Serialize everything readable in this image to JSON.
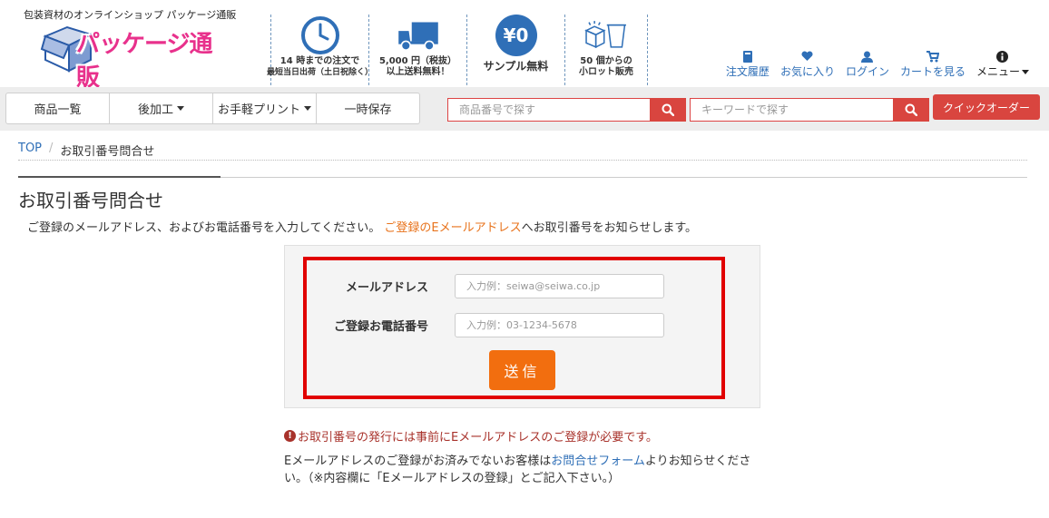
{
  "header": {
    "tagline": "包装資材のオンラインショップ パッケージ通販",
    "logo_text": "パッケージ通販",
    "features": [
      {
        "icon": "clock-icon",
        "line1": "14 時までの注文で",
        "line2": "最短当日出荷（土日祝除く）"
      },
      {
        "icon": "truck-icon",
        "line1": "5,000 円（税抜）",
        "line2": "以上送料無料！"
      },
      {
        "icon": "yen-zero-icon",
        "icon_text": "¥0",
        "line1": "サンプル無料",
        "line2": ""
      },
      {
        "icon": "box-cup-icon",
        "line1": "50 個からの",
        "line2": "小ロット販売"
      }
    ]
  },
  "user_nav": [
    {
      "icon": "book-icon",
      "label": "注文履歴"
    },
    {
      "icon": "heart-icon",
      "label": "お気に入り"
    },
    {
      "icon": "user-icon",
      "label": "ログイン"
    },
    {
      "icon": "cart-icon",
      "label": "カートを見る"
    },
    {
      "icon": "info-icon",
      "label": "メニュー"
    }
  ],
  "navbar": {
    "buttons": [
      {
        "label": "商品一覧",
        "dropdown": false
      },
      {
        "label": "後加工",
        "dropdown": true
      },
      {
        "label": "お手軽プリント",
        "dropdown": true
      },
      {
        "label": "一時保存",
        "dropdown": false
      }
    ],
    "search_code_placeholder": "商品番号で探す",
    "search_keyword_placeholder": "キーワードで探す",
    "quick_order": "クイックオーダー"
  },
  "breadcrumb": {
    "home": "TOP",
    "current": "お取引番号問合せ"
  },
  "page": {
    "title": "お取引番号問合せ",
    "intro_a": "ご登録のメールアドレス、およびお電話番号を入力してください。",
    "intro_hl": "ご登録のEメールアドレス",
    "intro_b": "へお取引番号をお知らせします。"
  },
  "form": {
    "email_label": "メールアドレス",
    "email_placeholder": "入力例：seiwa@seiwa.co.jp",
    "email_value": "",
    "phone_label": "ご登録お電話番号",
    "phone_placeholder": "入力例：03-1234-5678",
    "phone_value": "",
    "submit": "送信"
  },
  "notes": {
    "warning": "お取引番号の発行には事前にEメールアドレスのご登録が必要です。",
    "info_a": "Eメールアドレスのご登録がお済みでないお客様は",
    "info_link": "お問合せフォーム",
    "info_b": "よりお知らせください。（※内容欄に「Eメールアドレスの登録」とご記入下さい。）"
  },
  "colors": {
    "accent_red": "#d9453f",
    "link_blue": "#2f6fb7",
    "orange": "#f26e0f",
    "highlight_red": "#e10000"
  }
}
